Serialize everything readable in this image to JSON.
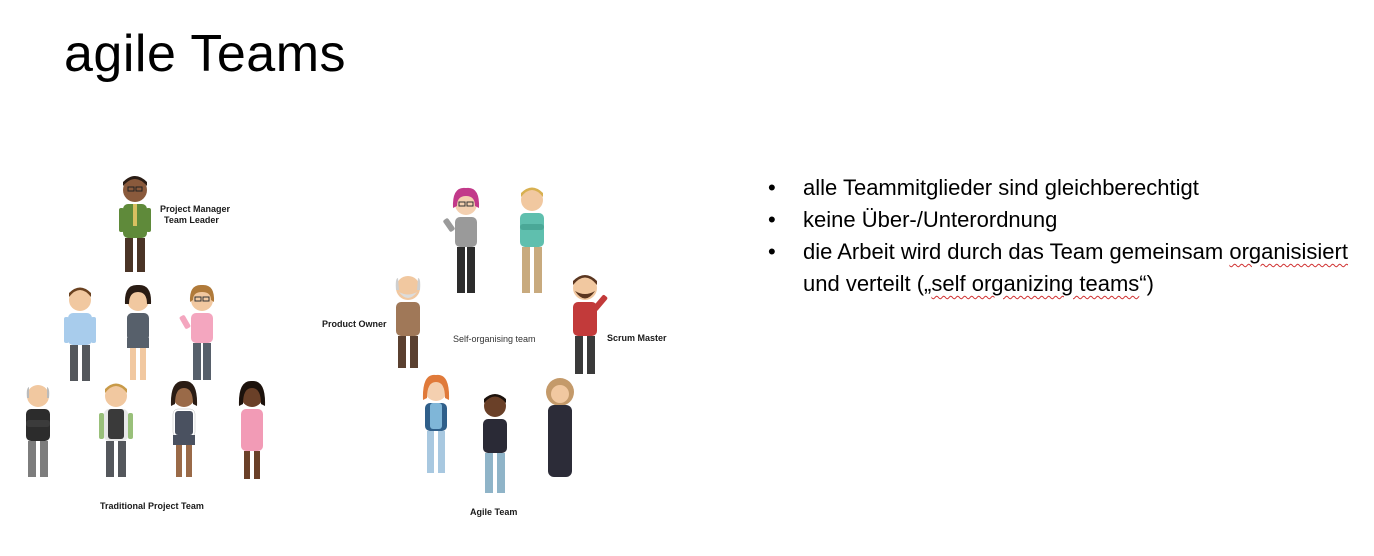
{
  "slide": {
    "title": "agile Teams"
  },
  "figure": {
    "label_pm_line1": "Project Manager",
    "label_pm_line2": "Team Leader",
    "label_traditional": "Traditional Project Team",
    "label_product_owner": "Product Owner",
    "label_self_org": "Self-organising team",
    "label_scrum_master": "Scrum Master",
    "label_agile": "Agile Team"
  },
  "bullets": {
    "item1": "alle Teammitglieder sind gleichberechtigt",
    "item2": "keine Über-/Unterordnung",
    "item3_a": "die Arbeit wird durch das Team gemeinsam ",
    "item3_b": "organisisiert",
    "item3_c": " und verteilt („",
    "item3_d": "self organizing teams",
    "item3_e": "“)"
  }
}
